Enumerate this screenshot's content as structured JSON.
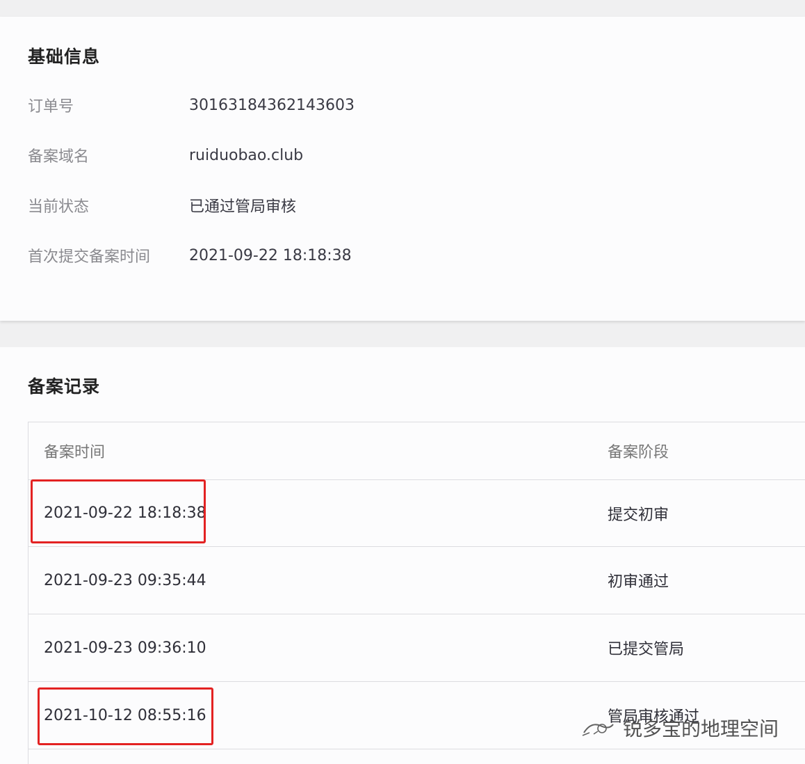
{
  "basic_info": {
    "title": "基础信息",
    "fields": [
      {
        "label": "订单号",
        "value": "30163184362143603"
      },
      {
        "label": "备案域名",
        "value": "ruiduobao.club"
      },
      {
        "label": "当前状态",
        "value": "已通过管局审核"
      },
      {
        "label": "首次提交备案时间",
        "value": "2021-09-22 18:18:38"
      }
    ]
  },
  "records": {
    "title": "备案记录",
    "columns": [
      "备案时间",
      "备案阶段"
    ],
    "rows": [
      {
        "time": "2021-09-22 18:18:38",
        "stage": "提交初审"
      },
      {
        "time": "2021-09-23 09:35:44",
        "stage": "初审通过"
      },
      {
        "time": "2021-09-23 09:36:10",
        "stage": "已提交管局"
      },
      {
        "time": "2021-10-12 08:55:16",
        "stage": "管局审核通过"
      }
    ]
  },
  "watermark": {
    "text": "锐多宝的地理空间"
  },
  "colors": {
    "highlight": "#e32222",
    "background": "#f0f0f1",
    "card": "#fcfcfd"
  }
}
